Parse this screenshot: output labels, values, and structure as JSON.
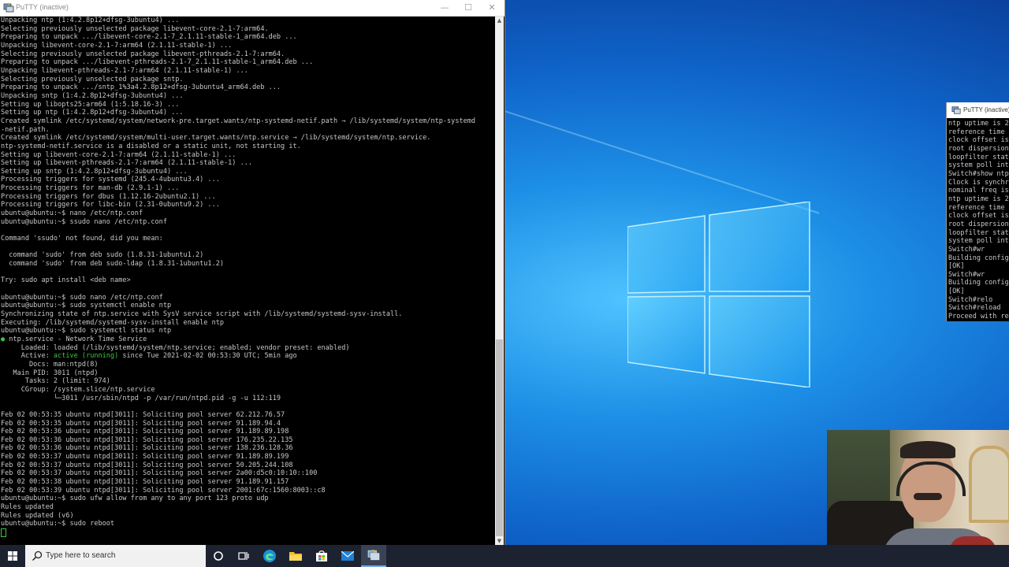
{
  "putty_main": {
    "title": "PuTTY (inactive)",
    "controls": {
      "minimize": "—",
      "maximize": "☐",
      "close": "✕"
    },
    "terminal_lines": [
      "Unpacking ntp (1:4.2.8p12+dfsg-3ubuntu4) ...",
      "Selecting previously unselected package libevent-core-2.1-7:arm64.",
      "Preparing to unpack .../libevent-core-2.1-7_2.1.11-stable-1_arm64.deb ...",
      "Unpacking libevent-core-2.1-7:arm64 (2.1.11-stable-1) ...",
      "Selecting previously unselected package libevent-pthreads-2.1-7:arm64.",
      "Preparing to unpack .../libevent-pthreads-2.1-7_2.1.11-stable-1_arm64.deb ...",
      "Unpacking libevent-pthreads-2.1-7:arm64 (2.1.11-stable-1) ...",
      "Selecting previously unselected package sntp.",
      "Preparing to unpack .../sntp_1%3a4.2.8p12+dfsg-3ubuntu4_arm64.deb ...",
      "Unpacking sntp (1:4.2.8p12+dfsg-3ubuntu4) ...",
      "Setting up libopts25:arm64 (1:5.18.16-3) ...",
      "Setting up ntp (1:4.2.8p12+dfsg-3ubuntu4) ...",
      "Created symlink /etc/systemd/system/network-pre.target.wants/ntp-systemd-netif.path → /lib/systemd/system/ntp-systemd",
      "-netif.path.",
      "Created symlink /etc/systemd/system/multi-user.target.wants/ntp.service → /lib/systemd/system/ntp.service.",
      "ntp-systemd-netif.service is a disabled or a static unit, not starting it.",
      "Setting up libevent-core-2.1-7:arm64 (2.1.11-stable-1) ...",
      "Setting up libevent-pthreads-2.1-7:arm64 (2.1.11-stable-1) ...",
      "Setting up sntp (1:4.2.8p12+dfsg-3ubuntu4) ...",
      "Processing triggers for systemd (245.4-4ubuntu3.4) ...",
      "Processing triggers for man-db (2.9.1-1) ...",
      "Processing triggers for dbus (1.12.16-2ubuntu2.1) ...",
      "Processing triggers for libc-bin (2.31-0ubuntu9.2) ...",
      "ubuntu@ubuntu:~$ nano /etc/ntp.conf",
      "ubuntu@ubuntu:~$ ssudo nano /etc/ntp.conf",
      "",
      "Command 'ssudo' not found, did you mean:",
      "",
      "  command 'sudo' from deb sudo (1.8.31-1ubuntu1.2)",
      "  command 'sudo' from deb sudo-ldap (1.8.31-1ubuntu1.2)",
      "",
      "Try: sudo apt install <deb name>",
      "",
      "ubuntu@ubuntu:~$ sudo nano /etc/ntp.conf",
      "ubuntu@ubuntu:~$ sudo systemctl enable ntp",
      "Synchronizing state of ntp.service with SysV service script with /lib/systemd/systemd-sysv-install.",
      "Executing: /lib/systemd/systemd-sysv-install enable ntp",
      "ubuntu@ubuntu:~$ sudo systemctl status ntp"
    ],
    "status_block": {
      "bullet": "●",
      "unit_line": " ntp.service - Network Time Service",
      "loaded": "     Loaded: loaded (/lib/systemd/system/ntp.service; enabled; vendor preset: enabled)",
      "active_prefix": "     Active: ",
      "active_state": "active (running)",
      "active_suffix": " since Tue 2021-02-02 00:53:30 UTC; 5min ago",
      "rest": [
        "       Docs: man:ntpd(8)",
        "   Main PID: 3011 (ntpd)",
        "      Tasks: 2 (limit: 974)",
        "     CGroup: /system.slice/ntp.service",
        "             └─3011 /usr/sbin/ntpd -p /var/run/ntpd.pid -g -u 112:119",
        "",
        "Feb 02 00:53:35 ubuntu ntpd[3011]: Soliciting pool server 62.212.76.57",
        "Feb 02 00:53:35 ubuntu ntpd[3011]: Soliciting pool server 91.189.94.4",
        "Feb 02 00:53:36 ubuntu ntpd[3011]: Soliciting pool server 91.189.89.198",
        "Feb 02 00:53:36 ubuntu ntpd[3011]: Soliciting pool server 176.235.22.135",
        "Feb 02 00:53:36 ubuntu ntpd[3011]: Soliciting pool server 138.236.128.36",
        "Feb 02 00:53:37 ubuntu ntpd[3011]: Soliciting pool server 91.189.89.199",
        "Feb 02 00:53:37 ubuntu ntpd[3011]: Soliciting pool server 50.205.244.108",
        "Feb 02 00:53:37 ubuntu ntpd[3011]: Soliciting pool server 2a00:d5c0:10:10::100",
        "Feb 02 00:53:38 ubuntu ntpd[3011]: Soliciting pool server 91.189.91.157",
        "Feb 02 00:53:39 ubuntu ntpd[3011]: Soliciting pool server 2001:67c:1560:8003::c8",
        "ubuntu@ubuntu:~$ sudo ufw allow from any to any port 123 proto udp",
        "Rules updated",
        "Rules updated (v6)",
        "ubuntu@ubuntu:~$ sudo reboot"
      ]
    }
  },
  "putty_second": {
    "title": "PuTTY (inactive)",
    "lines": [
      "ntp uptime is 2",
      "reference time i",
      "clock offset is",
      "root dispersion",
      "loopfilter stat",
      "system poll int",
      "Switch#show ntp",
      "Clock is synchr",
      "nominal freq is",
      "ntp uptime is 2",
      "reference time i",
      "clock offset is",
      "root dispersion",
      "loopfilter stat",
      "system poll int",
      "Switch#wr",
      "Building config",
      "[OK]",
      "Switch#wr",
      "Building config",
      "[OK]",
      "Switch#relo",
      "Switch#reload",
      "Proceed with re"
    ]
  },
  "taskbar": {
    "search_placeholder": "Type here to search",
    "items": [
      "start-icon",
      "cortana-icon",
      "task-view-icon",
      "edge-icon",
      "file-explorer-icon",
      "store-icon",
      "mail-icon",
      "putty-icon"
    ]
  },
  "colors": {
    "terminal_bg": "#000000",
    "terminal_fg": "#c8c8c8",
    "terminal_green": "#3ec43e",
    "taskbar_bg": "#1c2230",
    "desktop_accent": "#1d8fe6"
  }
}
